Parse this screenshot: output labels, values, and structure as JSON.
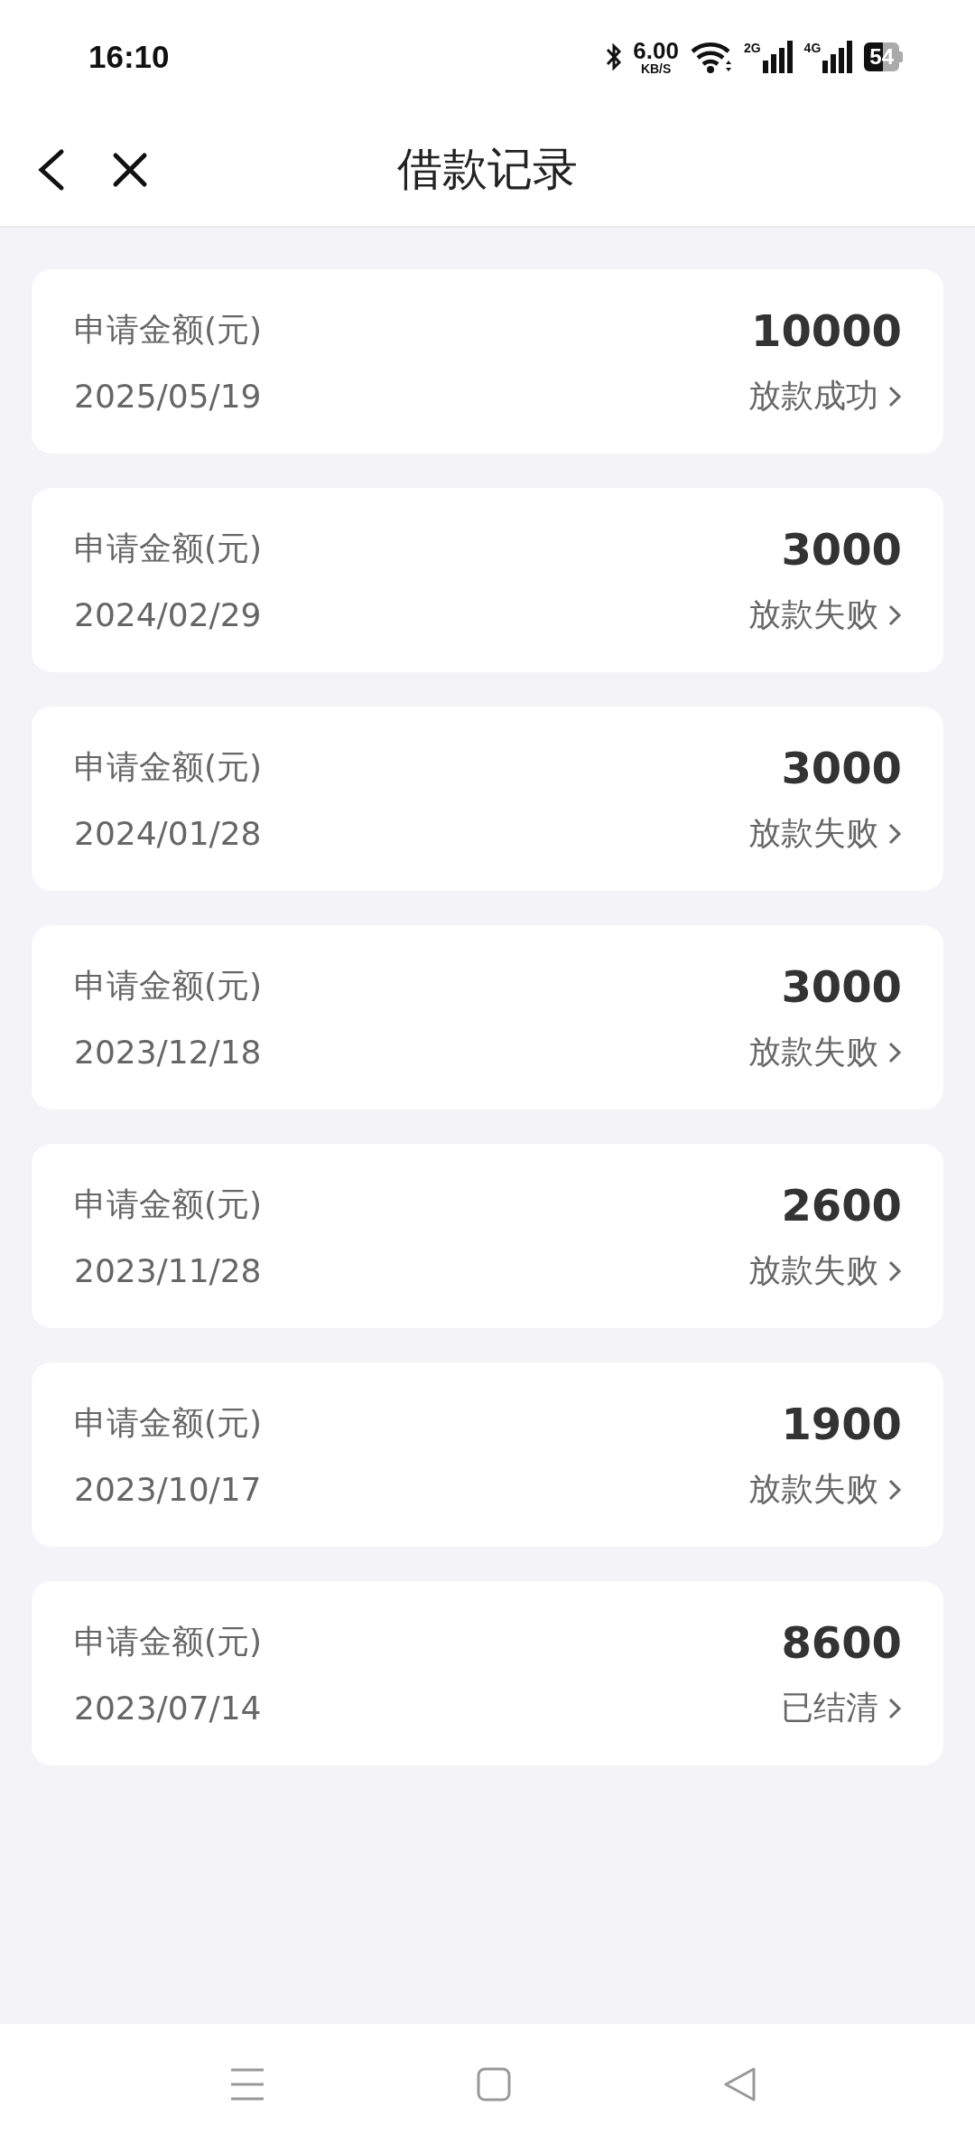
{
  "status_bar": {
    "time": "16:10",
    "net_speed": "6.00",
    "net_unit": "KB/S",
    "sim1": "2G",
    "sim2": "4G",
    "battery": "54"
  },
  "header": {
    "title": "借款记录"
  },
  "records": [
    {
      "label": "申请金额(元)",
      "amount": "10000",
      "date": "2025/05/19",
      "status": "放款成功"
    },
    {
      "label": "申请金额(元)",
      "amount": "3000",
      "date": "2024/02/29",
      "status": "放款失败"
    },
    {
      "label": "申请金额(元)",
      "amount": "3000",
      "date": "2024/01/28",
      "status": "放款失败"
    },
    {
      "label": "申请金额(元)",
      "amount": "3000",
      "date": "2023/12/18",
      "status": "放款失败"
    },
    {
      "label": "申请金额(元)",
      "amount": "2600",
      "date": "2023/11/28",
      "status": "放款失败"
    },
    {
      "label": "申请金额(元)",
      "amount": "1900",
      "date": "2023/10/17",
      "status": "放款失败"
    },
    {
      "label": "申请金额(元)",
      "amount": "8600",
      "date": "2023/07/14",
      "status": "已结清"
    }
  ]
}
